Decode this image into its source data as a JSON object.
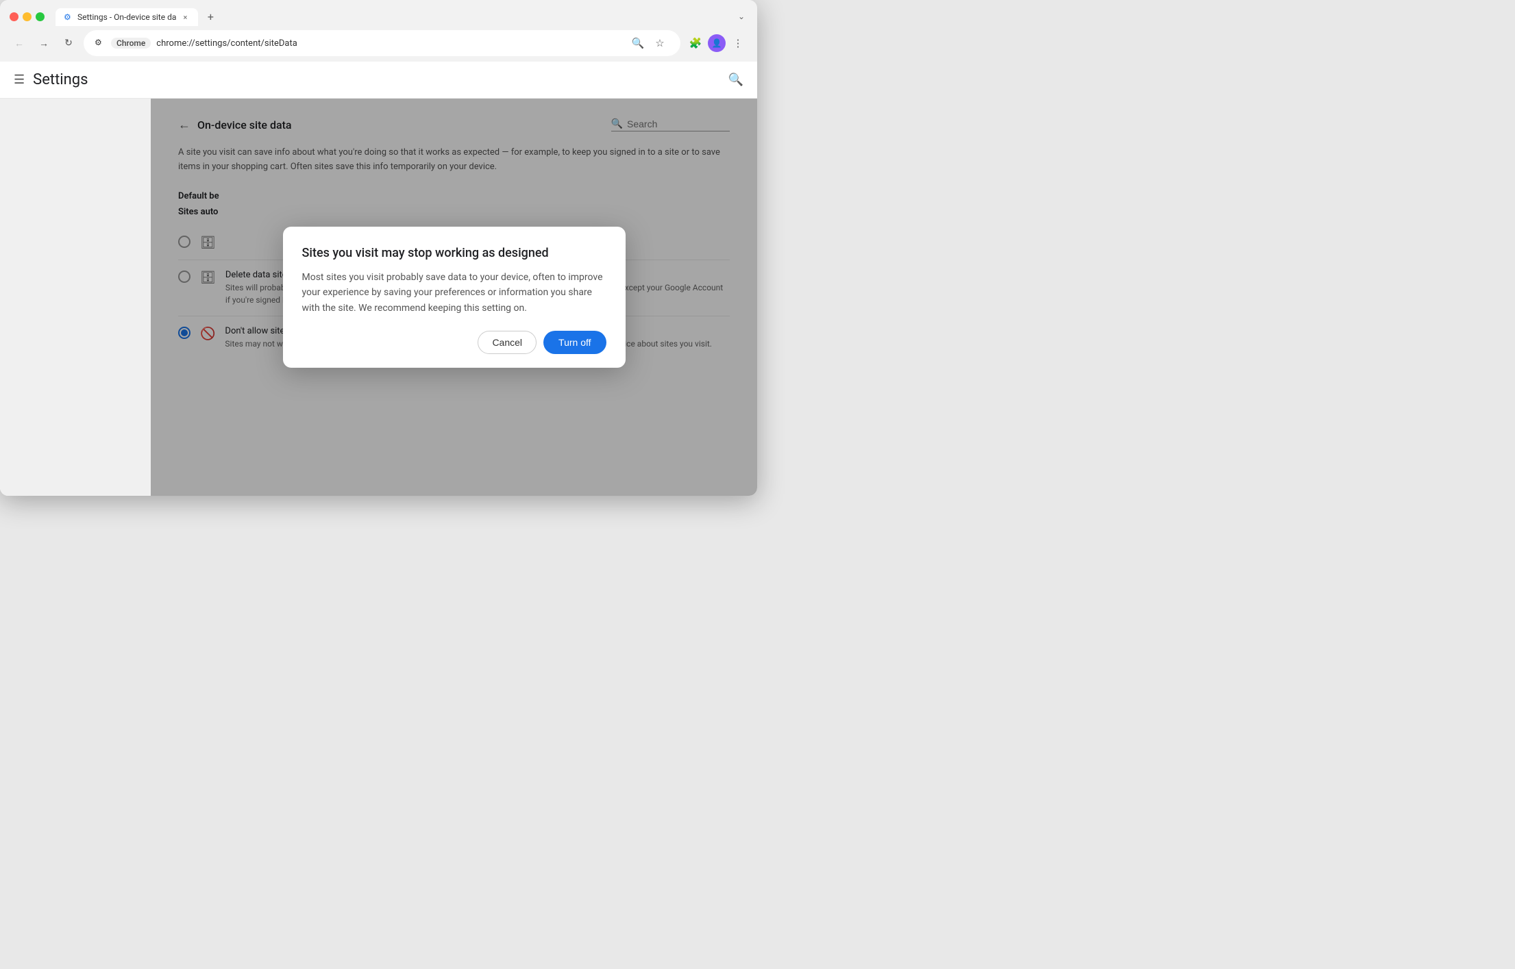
{
  "browser": {
    "tab_title": "Settings - On-device site da",
    "tab_close": "×",
    "tab_add": "+",
    "tab_dropdown": "⌄",
    "nav_back": "←",
    "nav_forward": "→",
    "nav_refresh": "↻",
    "address_badge": "Chrome",
    "address_url": "chrome://settings/content/siteData",
    "icon_zoom": "🔍",
    "icon_star": "☆",
    "icon_extensions": "🧩",
    "icon_menu": "⋮"
  },
  "settings": {
    "hamburger_label": "☰",
    "title": "Settings",
    "search_icon": "🔍",
    "back_arrow": "←",
    "page_title": "On-device site data",
    "search_placeholder": "Search",
    "description": "A site you visit can save info about what you're doing so that it works as expected — for example, to keep you signed in to a site or to save items in your shopping cart. Often sites save this info temporarily on your device.",
    "default_behavior_label": "Default be",
    "sites_auto_label": "Sites auto"
  },
  "options": [
    {
      "id": "opt1",
      "selected": false,
      "icon": "🗄",
      "title": "",
      "subtitle": ""
    },
    {
      "id": "opt2",
      "selected": false,
      "icon": "🗄",
      "title": "Delete data sites have saved to your device when you close all windows",
      "subtitle": "Sites will probably work as expected. You'll be signed out of most sites when you close all Chrome windows, except your Google Account if you're signed in to Chrome."
    },
    {
      "id": "opt3",
      "selected": true,
      "icon": "🚫",
      "title": "Don't allow sites to save data on your device (not recommended)",
      "subtitle": "Sites may not work as you would expect. Choose this option if you don't want to leave information on your device about sites you visit."
    }
  ],
  "dialog": {
    "title": "Sites you visit may stop working as designed",
    "body": "Most sites you visit probably save data to your device, often to improve your experience by saving your preferences or information you share with the site. We recommend keeping this setting on.",
    "cancel_label": "Cancel",
    "turn_off_label": "Turn off"
  }
}
